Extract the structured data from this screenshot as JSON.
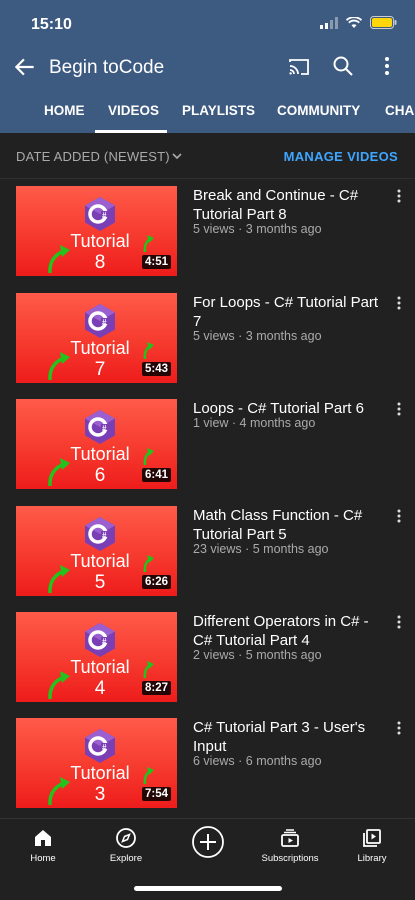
{
  "status": {
    "time": "15:10"
  },
  "header": {
    "channel_name": "Begin toCode"
  },
  "tabs": [
    {
      "label": "HOME"
    },
    {
      "label": "VIDEOS",
      "selected": true
    },
    {
      "label": "PLAYLISTS"
    },
    {
      "label": "COMMUNITY"
    },
    {
      "label": "CHA"
    }
  ],
  "sort": {
    "label": "DATE ADDED (NEWEST)",
    "manage_label": "MANAGE VIDEOS"
  },
  "videos": [
    {
      "title": "Break and Continue - C# Tutorial Part 8",
      "meta": "5 views · 3 months ago",
      "thumb_text": "Tutorial",
      "thumb_number": "8",
      "duration": "4:51"
    },
    {
      "title": "For Loops - C# Tutorial Part 7",
      "meta": "5 views · 3 months ago",
      "thumb_text": "Tutorial",
      "thumb_number": "7",
      "duration": "5:43"
    },
    {
      "title": "Loops - C# Tutorial Part 6",
      "meta": "1 view · 4 months ago",
      "thumb_text": "Tutorial",
      "thumb_number": "6",
      "duration": "6:41"
    },
    {
      "title": "Math Class Function - C# Tutorial Part 5",
      "meta": "23 views · 5 months ago",
      "thumb_text": "Tutorial",
      "thumb_number": "5",
      "duration": "6:26"
    },
    {
      "title": "Different Operators in C# - C# Tutorial Part 4",
      "meta": "2 views · 5 months ago",
      "thumb_text": "Tutorial",
      "thumb_number": "4",
      "duration": "8:27"
    },
    {
      "title": "C# Tutorial Part 3 - User's Input",
      "meta": "6 views · 6 months ago",
      "thumb_text": "Tutorial",
      "thumb_number": "3",
      "duration": "7:54"
    }
  ],
  "bottom_nav": [
    {
      "label": "Home",
      "icon": "home-icon"
    },
    {
      "label": "Explore",
      "icon": "compass-icon"
    },
    {
      "label": "",
      "icon": "create-plus-icon"
    },
    {
      "label": "Subscriptions",
      "icon": "subscriptions-icon"
    },
    {
      "label": "Library",
      "icon": "library-icon"
    }
  ],
  "colors": {
    "header_bg": "#3d5a80",
    "page_bg": "#212121",
    "accent_link": "#3ea6ff",
    "thumb_red": "#f63a2e",
    "arrow_green": "#23c21d"
  }
}
